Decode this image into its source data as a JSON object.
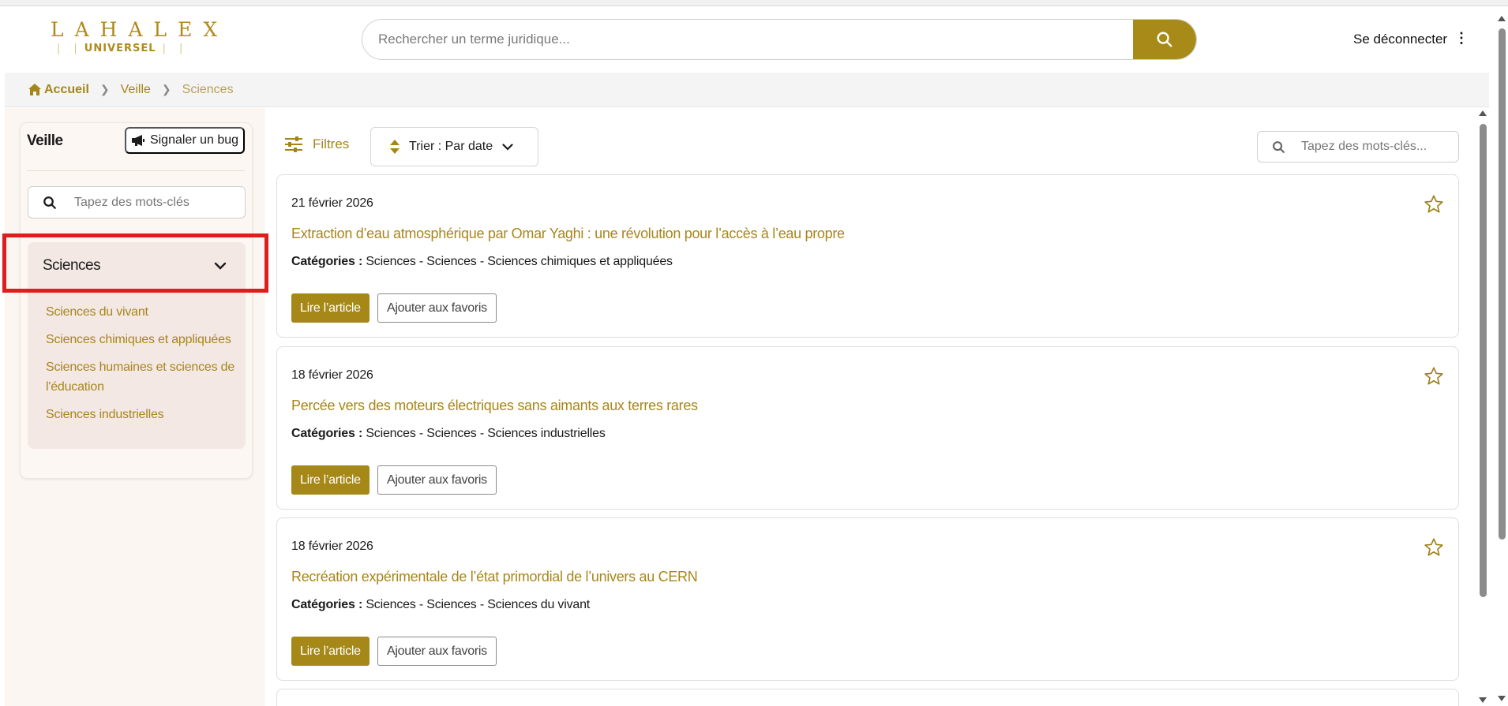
{
  "colors": {
    "accent": "#a78a17",
    "highlight": "#e01d1d"
  },
  "header": {
    "logo_top": "LAHALEX",
    "logo_bottom": "UNIVERSEL",
    "search_placeholder": "Rechercher un terme juridique...",
    "logout": "Se déconnecter",
    "menu_icon": "⋮"
  },
  "breadcrumb": {
    "home": "Accueil",
    "veille": "Veille",
    "current": "Sciences"
  },
  "sidebar": {
    "title": "Veille",
    "bug_label": "Signaler un bug",
    "search_placeholder": "Tapez des mots-clés",
    "category": "Sciences",
    "subcategories": [
      "Sciences du vivant",
      "Sciences chimiques et appliquées",
      "Sciences humaines et sciences de l'éducation",
      "Sciences industrielles"
    ]
  },
  "toolbar": {
    "filters_label": "Filtres",
    "sort_label": "Trier : Par date",
    "search_placeholder": "Tapez des mots-clés..."
  },
  "articles": [
    {
      "date": "21 février 2026",
      "title": "Extraction d’eau atmosphérique par Omar Yaghi : une révolution pour l’accès à l’eau propre",
      "categories_label": "Catégories :",
      "categories": "Sciences - Sciences - Sciences chimiques et appliquées",
      "read_label": "Lire l’article",
      "fav_label": "Ajouter aux favoris"
    },
    {
      "date": "18 février 2026",
      "title": "Percée vers des moteurs électriques sans aimants aux terres rares",
      "categories_label": "Catégories :",
      "categories": "Sciences - Sciences - Sciences industrielles",
      "read_label": "Lire l’article",
      "fav_label": "Ajouter aux favoris"
    },
    {
      "date": "18 février 2026",
      "title": "Recréation expérimentale de l’état primordial de l’univers au CERN",
      "categories_label": "Catégories :",
      "categories": "Sciences - Sciences - Sciences du vivant",
      "read_label": "Lire l’article",
      "fav_label": "Ajouter aux favoris"
    }
  ]
}
